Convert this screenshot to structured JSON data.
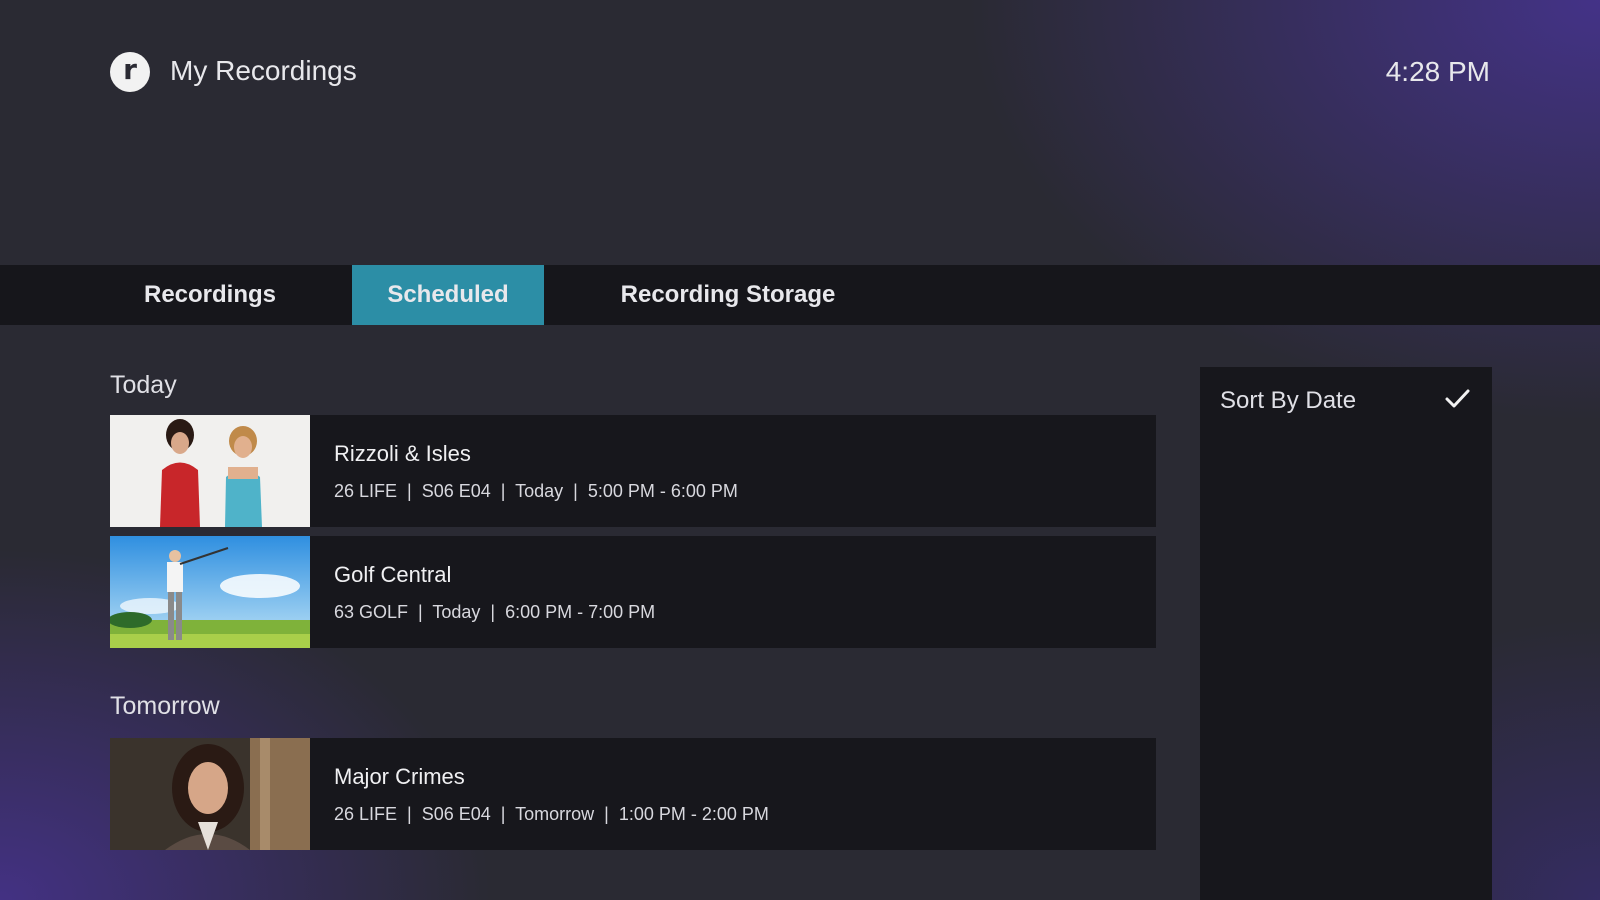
{
  "header": {
    "logo_letter": "r",
    "title": "My Recordings",
    "clock": "4:28 PM"
  },
  "tabs": [
    {
      "label": "Recordings",
      "active": false
    },
    {
      "label": "Scheduled",
      "active": true
    },
    {
      "label": "Recording Storage",
      "active": false
    }
  ],
  "sections": [
    {
      "label": "Today",
      "items": [
        {
          "title": "Rizzoli & Isles",
          "meta": "26 LIFE  |  S06 E04  |  Today  |  5:00 PM - 6:00 PM"
        },
        {
          "title": "Golf Central",
          "meta": "63 GOLF  |  Today  |  6:00 PM - 7:00 PM"
        }
      ]
    },
    {
      "label": "Tomorrow",
      "items": [
        {
          "title": "Major Crimes",
          "meta": "26 LIFE  |  S06 E04  |  Tomorrow  |  1:00 PM - 2:00 PM"
        }
      ]
    }
  ],
  "sort_panel": {
    "label": "Sort By Date",
    "checked": true,
    "icon": "check-icon"
  },
  "colors": {
    "accent_tab": "#2c8ea6",
    "card_bg": "#17171c",
    "tabbar_bg": "#16161b"
  }
}
